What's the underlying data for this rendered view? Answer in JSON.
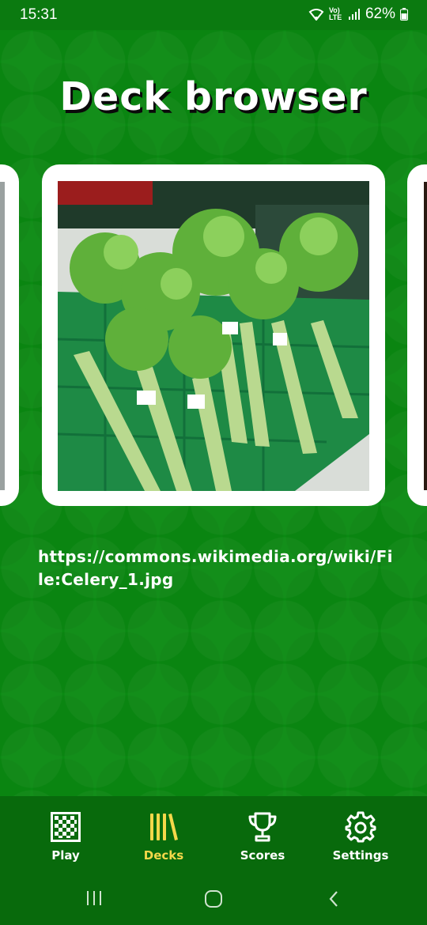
{
  "status": {
    "time": "15:31",
    "network_label": "Vo) LTE",
    "battery_percent": "62%",
    "icons": [
      "wifi-icon",
      "lte-icon",
      "signal-icon",
      "battery-icon"
    ]
  },
  "header": {
    "title": "Deck browser"
  },
  "deck": {
    "image_description_icon": "celery-photo",
    "source_url": "https://commons.wikimedia.org/wiki/File:Celery_1.jpg"
  },
  "bottom_nav": {
    "items": [
      {
        "label": "Play",
        "icon": "grid-icon",
        "active": false
      },
      {
        "label": "Decks",
        "icon": "library-icon",
        "active": true
      },
      {
        "label": "Scores",
        "icon": "trophy-icon",
        "active": false
      },
      {
        "label": "Settings",
        "icon": "gear-icon",
        "active": false
      }
    ]
  },
  "system_nav": {
    "icons": [
      "recents-icon",
      "home-icon",
      "back-icon"
    ]
  },
  "colors": {
    "background": "#0a8a12",
    "nav_background": "#086a0c",
    "active": "#f4d84a",
    "text": "#ffffff"
  }
}
